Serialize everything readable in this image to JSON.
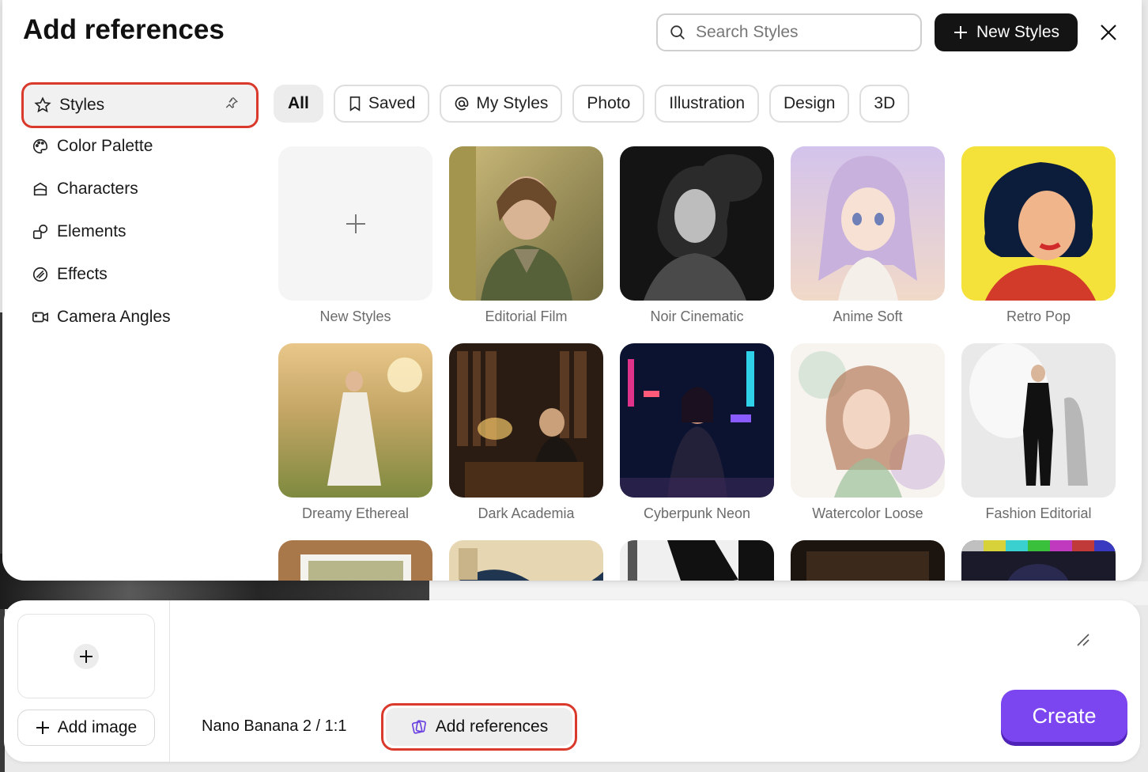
{
  "modal": {
    "title": "Add references",
    "search_placeholder": "Search Styles",
    "new_styles_label": "New Styles"
  },
  "sidebar": {
    "items": [
      {
        "label": "Styles",
        "icon": "star-icon"
      },
      {
        "label": "Color Palette",
        "icon": "palette-icon"
      },
      {
        "label": "Characters",
        "icon": "character-icon"
      },
      {
        "label": "Elements",
        "icon": "elements-icon"
      },
      {
        "label": "Effects",
        "icon": "effects-icon"
      },
      {
        "label": "Camera Angles",
        "icon": "camera-icon"
      }
    ]
  },
  "filters": [
    {
      "label": "All",
      "active": true
    },
    {
      "label": "Saved",
      "icon": "bookmark-icon"
    },
    {
      "label": "My Styles",
      "icon": "at-icon"
    },
    {
      "label": "Photo"
    },
    {
      "label": "Illustration"
    },
    {
      "label": "Design"
    },
    {
      "label": "3D"
    }
  ],
  "styles": [
    {
      "label": "New Styles"
    },
    {
      "label": "Editorial Film"
    },
    {
      "label": "Noir Cinematic"
    },
    {
      "label": "Anime Soft"
    },
    {
      "label": "Retro Pop"
    },
    {
      "label": "Dreamy Ethereal"
    },
    {
      "label": "Dark Academia"
    },
    {
      "label": "Cyberpunk Neon"
    },
    {
      "label": "Watercolor Loose"
    },
    {
      "label": "Fashion Editorial"
    }
  ],
  "composer": {
    "add_image_label": "Add image",
    "model_label": "Nano Banana 2 / 1:1",
    "add_references_label": "Add references",
    "create_label": "Create"
  },
  "colors": {
    "accent": "#7b45f0",
    "highlight": "#d93a2b"
  }
}
